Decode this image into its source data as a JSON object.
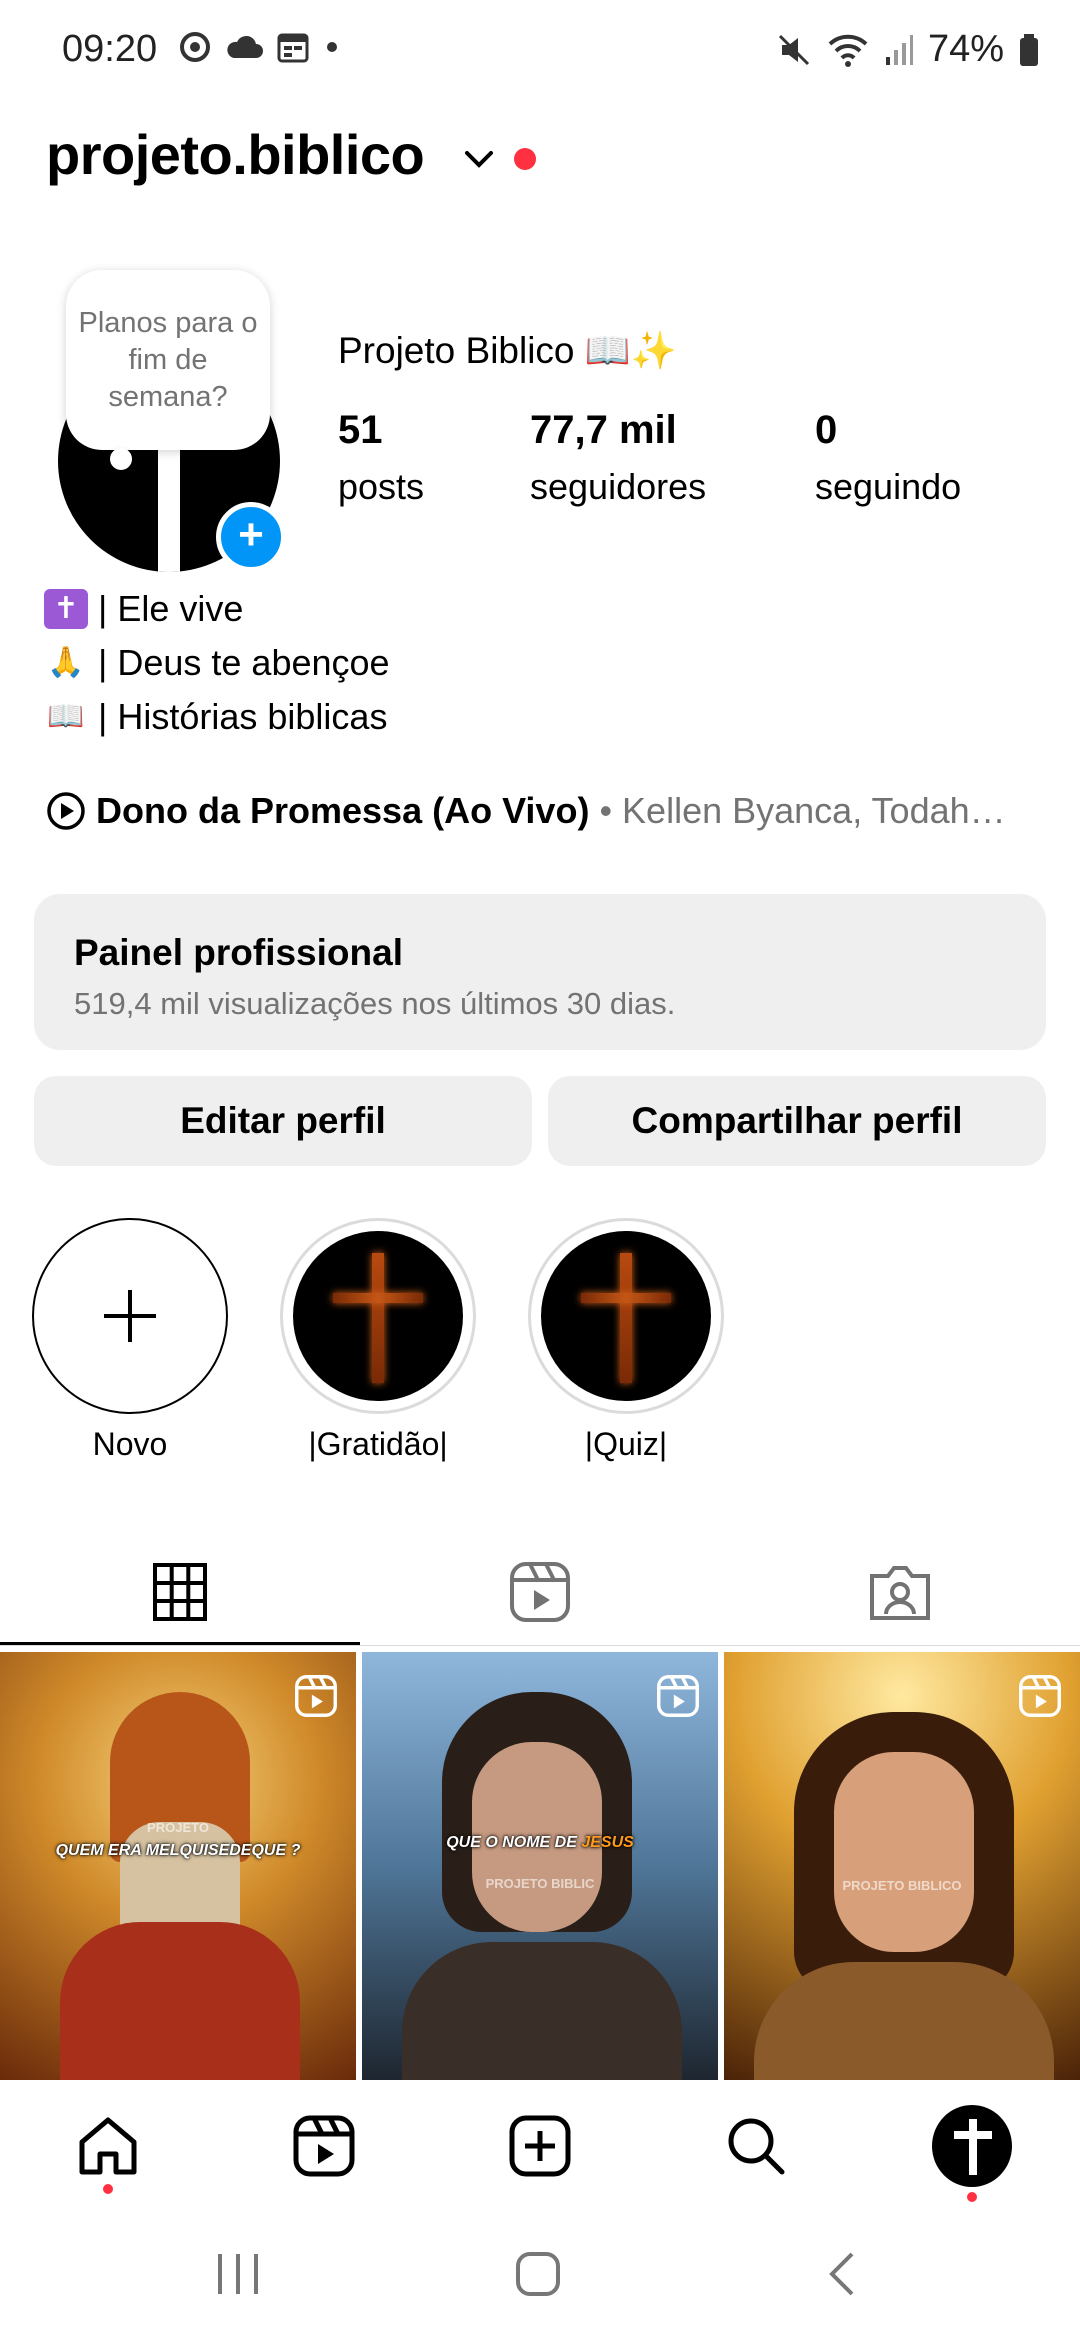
{
  "status_bar": {
    "time": "09:20",
    "battery": "74%",
    "left_icons": [
      "screen-time-icon",
      "cloud-icon",
      "calendar-icon",
      "dot-icon"
    ],
    "right_icons": [
      "mute-icon",
      "wifi-icon",
      "signal-icon",
      "battery-icon"
    ]
  },
  "header": {
    "username": "projeto.biblico",
    "icons": [
      "chevron-down-icon",
      "notification-dot"
    ]
  },
  "note": {
    "text": "Planos para o fim de semana?"
  },
  "profile": {
    "display_name": "Projeto Biblico 📖✨",
    "stats": [
      {
        "value": "51",
        "label": "posts"
      },
      {
        "value": "77,7 mil",
        "label": "seguidores"
      },
      {
        "value": "0",
        "label": "seguindo"
      }
    ],
    "bio": [
      {
        "emoji": "✝",
        "text": "| Ele vive"
      },
      {
        "emoji": "🙏",
        "text": "| Deus te abençoe"
      },
      {
        "emoji": "📖",
        "text": "| Histórias biblicas"
      }
    ]
  },
  "music": {
    "song": "Dono da Promessa (Ao Vivo)",
    "artist": "• Kellen Byanca, Todah…"
  },
  "dashboard": {
    "title": "Painel profissional",
    "subtitle": "519,4 mil visualizações nos últimos 30 dias."
  },
  "buttons": {
    "edit": "Editar perfil",
    "share": "Compartilhar perfil"
  },
  "highlights": [
    {
      "label": "Novo"
    },
    {
      "label": "|Gratidão|"
    },
    {
      "label": "|Quiz|"
    }
  ],
  "tabs": [
    "grid-icon",
    "reels-icon",
    "tagged-icon"
  ],
  "posts": [
    {
      "caption": "QUEM ERA MELQUISEDEQUE ?",
      "watermark": "PROJETO",
      "colors": [
        "#e0a53a",
        "#8a3a0e"
      ]
    },
    {
      "caption": "QUE O NOME DE JESUS",
      "caption_highlight": "JESUS",
      "watermark": "PROJETO BIBLIC",
      "colors": [
        "#6f9ec9",
        "#2a3a4a"
      ]
    },
    {
      "caption": "",
      "watermark": "PROJETO BIBLICO",
      "colors": [
        "#f2c14e",
        "#5a2f0a"
      ]
    }
  ],
  "bottom_nav": [
    "home-icon",
    "reels-icon",
    "create-icon",
    "search-icon",
    "profile-avatar"
  ],
  "system_nav": [
    "recents-icon",
    "home-button-icon",
    "back-icon"
  ]
}
